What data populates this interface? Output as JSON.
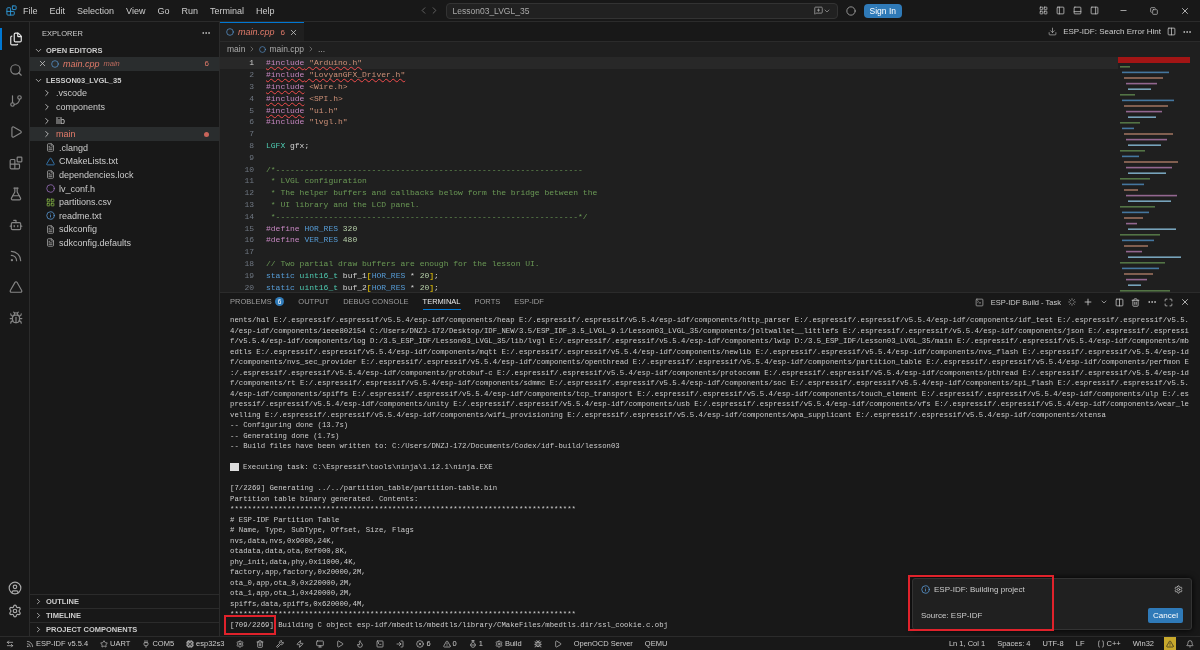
{
  "menu": [
    "File",
    "Edit",
    "Selection",
    "View",
    "Go",
    "Run",
    "Terminal",
    "Help"
  ],
  "command_center": {
    "value": "Lesson03_LVGL_35"
  },
  "sign_in": "Sign In",
  "activity_bar": [
    {
      "selected": true
    },
    {
      "selected": false
    },
    {
      "selected": false
    },
    {
      "selected": false
    },
    {
      "selected": false
    },
    {
      "selected": false
    },
    {
      "selected": false
    },
    {
      "selected": false
    },
    {
      "selected": false
    },
    {
      "selected": false
    }
  ],
  "sidebar": {
    "title": "EXPLORER",
    "open_editors": {
      "label": "OPEN EDITORS",
      "items": [
        {
          "name": "main.cpp",
          "folder": "main",
          "count": "6"
        }
      ]
    },
    "project": {
      "label": "LESSON03_LVGL_35",
      "items": [
        {
          "name": ".vscode",
          "kind": "folder",
          "selected": false,
          "modified": false
        },
        {
          "name": "components",
          "kind": "folder",
          "selected": false,
          "modified": false
        },
        {
          "name": "lib",
          "kind": "folder",
          "selected": false,
          "modified": false
        },
        {
          "name": "main",
          "kind": "folder",
          "selected": true,
          "modified": true
        },
        {
          "name": ".clangd",
          "kind": "file",
          "selected": false,
          "modified": false
        },
        {
          "name": "CMakeLists.txt",
          "kind": "cmake",
          "selected": false,
          "modified": false
        },
        {
          "name": "dependencies.lock",
          "kind": "file",
          "selected": false,
          "modified": false
        },
        {
          "name": "lv_conf.h",
          "kind": "header",
          "selected": false,
          "modified": false
        },
        {
          "name": "partitions.csv",
          "kind": "table",
          "selected": false,
          "modified": false
        },
        {
          "name": "readme.txt",
          "kind": "info",
          "selected": false,
          "modified": false
        },
        {
          "name": "sdkconfig",
          "kind": "file",
          "selected": false,
          "modified": false
        },
        {
          "name": "sdkconfig.defaults",
          "kind": "file",
          "selected": false,
          "modified": false
        }
      ]
    },
    "sections": [
      "OUTLINE",
      "TIMELINE",
      "PROJECT COMPONENTS"
    ]
  },
  "editor": {
    "tab": {
      "name": "main.cpp",
      "count": "6"
    },
    "actions": {
      "hint": "ESP-IDF: Search Error Hint"
    },
    "breadcrumb": [
      "main",
      "main.cpp",
      "..."
    ],
    "lines": [
      {
        "n": "1",
        "current": true,
        "tokens": [
          {
            "text": "#include",
            "kind": "directive",
            "error": true
          },
          {
            "text": " \"Arduino.h\"",
            "kind": "string",
            "error": true
          }
        ]
      },
      {
        "n": "2",
        "current": false,
        "tokens": [
          {
            "text": "#include",
            "kind": "directive",
            "error": true
          },
          {
            "text": " \"LovyanGFX_Driver.h\"",
            "kind": "string",
            "error": true
          }
        ]
      },
      {
        "n": "3",
        "current": false,
        "tokens": [
          {
            "text": "#include",
            "kind": "directive",
            "error": true
          },
          {
            "text": " <Wire.h>",
            "kind": "string"
          }
        ]
      },
      {
        "n": "4",
        "current": false,
        "tokens": [
          {
            "text": "#include",
            "kind": "directive",
            "error": true
          },
          {
            "text": " <SPI.h>",
            "kind": "string"
          }
        ]
      },
      {
        "n": "5",
        "current": false,
        "tokens": [
          {
            "text": "#include",
            "kind": "directive",
            "error": true
          },
          {
            "text": " \"ui.h\"",
            "kind": "string"
          }
        ]
      },
      {
        "n": "6",
        "current": false,
        "tokens": [
          {
            "text": "#include",
            "kind": "directive"
          },
          {
            "text": " \"lvgl.h\"",
            "kind": "string"
          }
        ]
      },
      {
        "n": "7",
        "current": false
      },
      {
        "n": "8",
        "current": false,
        "tokens": [
          {
            "text": "LGFX",
            "kind": "type"
          },
          {
            "text": " gfx;",
            "kind": "plain"
          }
        ]
      },
      {
        "n": "9",
        "current": false
      },
      {
        "n": "10",
        "current": false,
        "tokens": [
          {
            "text": "/*----------------------------------------------------------------",
            "kind": "comment"
          }
        ]
      },
      {
        "n": "11",
        "current": false,
        "tokens": [
          {
            "text": " * LVGL configuration",
            "kind": "comment"
          }
        ]
      },
      {
        "n": "12",
        "current": false,
        "tokens": [
          {
            "text": " * The helper buffers and callbacks below form the bridge between the",
            "kind": "comment"
          }
        ]
      },
      {
        "n": "13",
        "current": false,
        "tokens": [
          {
            "text": " * UI library and the LCD panel.",
            "kind": "comment"
          }
        ]
      },
      {
        "n": "14",
        "current": false,
        "tokens": [
          {
            "text": " *---------------------------------------------------------------*/",
            "kind": "comment"
          }
        ]
      },
      {
        "n": "15",
        "current": false,
        "tokens": [
          {
            "text": "#define",
            "kind": "directive"
          },
          {
            "text": " HOR_RES",
            "kind": "macro"
          },
          {
            "text": " 320",
            "kind": "number"
          }
        ]
      },
      {
        "n": "16",
        "current": false,
        "tokens": [
          {
            "text": "#define",
            "kind": "directive"
          },
          {
            "text": " VER_RES",
            "kind": "macro"
          },
          {
            "text": " 480",
            "kind": "number"
          }
        ]
      },
      {
        "n": "17",
        "current": false
      },
      {
        "n": "18",
        "current": false,
        "tokens": [
          {
            "text": "// Two partial draw buffers are enough for the lesson UI.",
            "kind": "comment"
          }
        ]
      },
      {
        "n": "19",
        "current": false,
        "tokens": [
          {
            "text": "static",
            "kind": "keyword"
          },
          {
            "text": " uint16_t",
            "kind": "type"
          },
          {
            "text": " buf_1",
            "kind": "plain"
          },
          {
            "text": "[",
            "kind": "bracket"
          },
          {
            "text": "HOR_RES",
            "kind": "macro"
          },
          {
            "text": " * ",
            "kind": "plain"
          },
          {
            "text": "20",
            "kind": "number"
          },
          {
            "text": "]",
            "kind": "bracket"
          },
          {
            "text": ";",
            "kind": "plain"
          }
        ]
      },
      {
        "n": "20",
        "current": false,
        "tokens": [
          {
            "text": "static",
            "kind": "keyword"
          },
          {
            "text": " uint16_t",
            "kind": "type"
          },
          {
            "text": " buf_2",
            "kind": "plain"
          },
          {
            "text": "[",
            "kind": "bracket"
          },
          {
            "text": "HOR_RES",
            "kind": "macro"
          },
          {
            "text": " * ",
            "kind": "plain"
          },
          {
            "text": "20",
            "kind": "number"
          },
          {
            "text": "]",
            "kind": "bracket"
          },
          {
            "text": ";",
            "kind": "plain"
          }
        ]
      }
    ]
  },
  "panel": {
    "tabs": [
      {
        "label": "PROBLEMS",
        "badge": "6",
        "selected": false
      },
      {
        "label": "OUTPUT",
        "selected": false
      },
      {
        "label": "DEBUG CONSOLE",
        "selected": false
      },
      {
        "label": "TERMINAL",
        "selected": true
      },
      {
        "label": "PORTS",
        "selected": false
      },
      {
        "label": "ESP-IDF",
        "selected": false
      }
    ],
    "task": "ESP-IDF Build - Task",
    "terminal": [
      {
        "kind": "output",
        "text": "nents/hal E:/.espressif/.espressif/v5.5.4/esp-idf/components/heap E:/.espressif/.espressif/v5.5.4/esp-idf/components/http_parser E:/.espressif/.espressif/v5.5.4/esp-idf/components/idf_test E:/.espressif/.espressif/v5.5."
      },
      {
        "kind": "output",
        "text": "4/esp-idf/components/ieee802154 C:/Users/DNZJ-172/Desktop/IDF_NEW/3.5/ESP_IDF_3.5_LVGL_9.1/Lesson03_LVGL_35/components/joltwallet__littlefs E:/.espressif/.espressif/v5.5.4/esp-idf/components/json E:/.espressif/.espressi"
      },
      {
        "kind": "output",
        "text": "f/v5.5.4/esp-idf/components/log D:/3.5_ESP_IDF/Lesson03_LVGL_35/lib/lvgl E:/.espressif/.espressif/v5.5.4/esp-idf/components/lwip D:/3.5_ESP_IDF/Lesson03_LVGL_35/main E:/.espressif/.espressif/v5.5.4/esp-idf/components/mb"
      },
      {
        "kind": "output",
        "text": "edtls E:/.espressif/.espressif/v5.5.4/esp-idf/components/mqtt E:/.espressif/.espressif/v5.5.4/esp-idf/components/newlib E:/.espressif/.espressif/v5.5.4/esp-idf/components/nvs_flash E:/.espressif/.espressif/v5.5.4/esp-id"
      },
      {
        "kind": "output",
        "text": "f/components/nvs_sec_provider E:/.espressif/.espressif/v5.5.4/esp-idf/components/openthread E:/.espressif/.espressif/v5.5.4/esp-idf/components/partition_table E:/.espressif/.espressif/v5.5.4/esp-idf/components/perfmon E"
      },
      {
        "kind": "output",
        "text": ":/.espressif/.espressif/v5.5.4/esp-idf/components/protobuf-c E:/.espressif/.espressif/v5.5.4/esp-idf/components/protocomm E:/.espressif/.espressif/v5.5.4/esp-idf/components/pthread E:/.espressif/.espressif/v5.5.4/esp-id"
      },
      {
        "kind": "output",
        "text": "f/components/rt E:/.espressif/.espressif/v5.5.4/esp-idf/components/sdmmc E:/.espressif/.espressif/v5.5.4/esp-idf/components/soc E:/.espressif/.espressif/v5.5.4/esp-idf/components/spi_flash E:/.espressif/.espressif/v5.5."
      },
      {
        "kind": "output",
        "text": "4/esp-idf/components/spiffs E:/.espressif/.espressif/v5.5.4/esp-idf/components/tcp_transport E:/.espressif/.espressif/v5.5.4/esp-idf/components/touch_element E:/.espressif/.espressif/v5.5.4/esp-idf/components/ulp E:/.es"
      },
      {
        "kind": "output",
        "text": "pressif/.espressif/v5.5.4/esp-idf/components/unity E:/.espressif/.espressif/v5.5.4/esp-idf/components/usb E:/.espressif/.espressif/v5.5.4/esp-idf/components/vfs E:/.espressif/.espressif/v5.5.4/esp-idf/components/wear_le"
      },
      {
        "kind": "output",
        "text": "velling E:/.espressif/.espressif/v5.5.4/esp-idf/components/wifi_provisioning E:/.espressif/.espressif/v5.5.4/esp-idf/components/wpa_supplicant E:/.espressif/.espressif/v5.5.4/esp-idf/components/xtensa"
      },
      {
        "kind": "output",
        "text": "-- Configuring done (13.7s)"
      },
      {
        "kind": "output",
        "text": "-- Generating done (1.7s)"
      },
      {
        "kind": "output",
        "text": "-- Build files have been written to: C:/Users/DNZJ-172/Documents/Codex/idf-build/lesson03"
      },
      {
        "kind": "blank"
      },
      {
        "kind": "task",
        "text": "Executing task: C:\\Espressif\\tools\\ninja\\1.12.1\\ninja.EXE"
      },
      {
        "kind": "blank"
      },
      {
        "kind": "output",
        "text": "[7/2269] Generating ../../partition_table/partition-table.bin"
      },
      {
        "kind": "output",
        "text": "Partition table binary generated. Contents:"
      },
      {
        "kind": "output",
        "text": "*******************************************************************************"
      },
      {
        "kind": "output",
        "text": "# ESP-IDF Partition Table"
      },
      {
        "kind": "output",
        "text": "# Name, Type, SubType, Offset, Size, Flags"
      },
      {
        "kind": "output",
        "text": "nvs,data,nvs,0x9000,24K,"
      },
      {
        "kind": "output",
        "text": "otadata,data,ota,0xf000,8K,"
      },
      {
        "kind": "output",
        "text": "phy_init,data,phy,0x11000,4K,"
      },
      {
        "kind": "output",
        "text": "factory,app,factory,0x20000,2M,"
      },
      {
        "kind": "output",
        "text": "ota_0,app,ota_0,0x220000,2M,"
      },
      {
        "kind": "output",
        "text": "ota_1,app,ota_1,0x420000,2M,"
      },
      {
        "kind": "output",
        "text": "spiffs,data,spiffs,0x620000,4M,"
      },
      {
        "kind": "output",
        "text": "*******************************************************************************"
      },
      {
        "kind": "highlighted",
        "text": "[709/2269] Building C object esp-idf/mbedtls/mbedtls/library/CMakeFiles/mbedtls.dir/ssl_cookie.c.obj"
      }
    ]
  },
  "notification": {
    "message": "ESP-IDF: Building project",
    "source": "Source: ESP-IDF",
    "button": "Cancel"
  },
  "status_bar": {
    "left": [
      {
        "kind": "remote"
      },
      {
        "kind": "esp",
        "text": "ESP-IDF v5.5.4"
      },
      {
        "kind": "star",
        "text": "UART"
      },
      {
        "kind": "plug",
        "text": "COM5"
      },
      {
        "kind": "chip",
        "text": "esp32s3"
      },
      {
        "kind": "gear"
      },
      {
        "kind": "trash"
      },
      {
        "kind": "wrench"
      },
      {
        "kind": "zap"
      },
      {
        "kind": "monitor"
      },
      {
        "kind": "debug"
      },
      {
        "kind": "flame"
      },
      {
        "kind": "terminal"
      },
      {
        "kind": "export"
      },
      {
        "kind": "error",
        "text": "6"
      },
      {
        "kind": "warning",
        "text": "0"
      },
      {
        "kind": "tests",
        "text": "1"
      },
      {
        "kind": "gear",
        "text": "Build"
      },
      {
        "kind": "bug"
      },
      {
        "kind": "play"
      },
      {
        "kind": "plain",
        "text": "OpenOCD Server"
      },
      {
        "kind": "plain",
        "text": "QEMU"
      }
    ],
    "right": [
      {
        "kind": "plain",
        "text": "Ln 1, Col 1"
      },
      {
        "kind": "plain",
        "text": "Spaces: 4"
      },
      {
        "kind": "plain",
        "text": "UTF-8"
      },
      {
        "kind": "plain",
        "text": "LF"
      },
      {
        "kind": "braces",
        "text": "C++"
      },
      {
        "kind": "plain",
        "text": "Win32"
      },
      {
        "kind": "warning-badge"
      },
      {
        "kind": "bell"
      }
    ]
  }
}
